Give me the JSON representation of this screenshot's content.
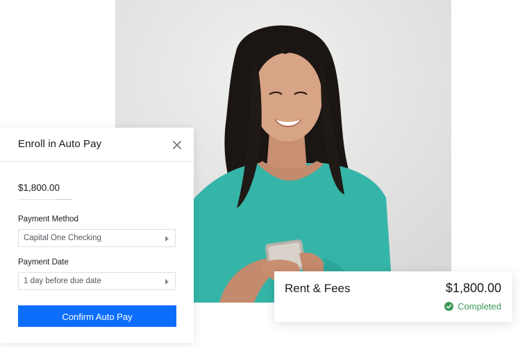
{
  "photo": {
    "icon": "woman-holding-phone-photo"
  },
  "enroll_modal": {
    "title": "Enroll in Auto Pay",
    "close_icon": "close-icon",
    "amount": "$1,800.00",
    "payment_method": {
      "label": "Payment Method",
      "value": "Capital One Checking"
    },
    "payment_date": {
      "label": "Payment Date",
      "value": "1 day before due date"
    },
    "confirm_label": "Confirm Auto Pay",
    "accent_color": "#0d6efd"
  },
  "payment_card": {
    "title": "Rent & Fees",
    "amount": "$1,800.00",
    "status": "Completed",
    "status_icon": "check-circle-icon",
    "status_color": "#3d9a5b"
  }
}
